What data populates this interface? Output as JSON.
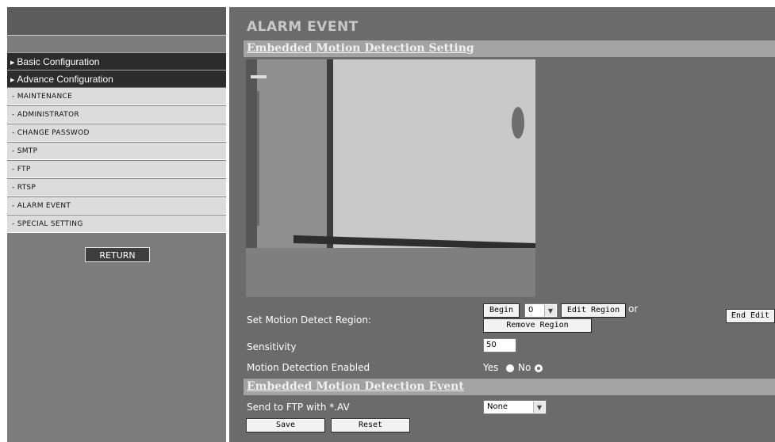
{
  "sidebar": {
    "sections": [
      {
        "label": "Basic Configuration"
      },
      {
        "label": "Advance Configuration"
      }
    ],
    "items": [
      {
        "label": "- MAINTENANCE"
      },
      {
        "label": "- ADMINISTRATOR"
      },
      {
        "label": "- CHANGE PASSWOD"
      },
      {
        "label": "- SMTP"
      },
      {
        "label": "- FTP"
      },
      {
        "label": "- RTSP"
      },
      {
        "label": "- ALARM EVENT"
      },
      {
        "label": "- SPECIAL SETTING"
      }
    ],
    "return_label": "RETURN"
  },
  "main": {
    "title": "ALARM EVENT",
    "setting_header": "Embedded Motion Detection Setting",
    "region_label": "Set Motion Detect Region:",
    "begin_label": "Begin",
    "region_select_value": "0",
    "edit_region_label": "Edit Region",
    "or_text": "or",
    "end_edit_label": "End Edit",
    "remove_region_label": "Remove Region",
    "sensitivity_label": "Sensitivity",
    "sensitivity_value": "50",
    "motion_enabled_label": "Motion Detection Enabled",
    "yes_label": "Yes",
    "no_label": "No",
    "motion_enabled_selected": "No",
    "event_header": "Embedded Motion Detection Event",
    "ftp_label": "Send to FTP with *.AV",
    "ftp_select_value": "None",
    "save_label": "Save",
    "reset_label": "Reset"
  }
}
